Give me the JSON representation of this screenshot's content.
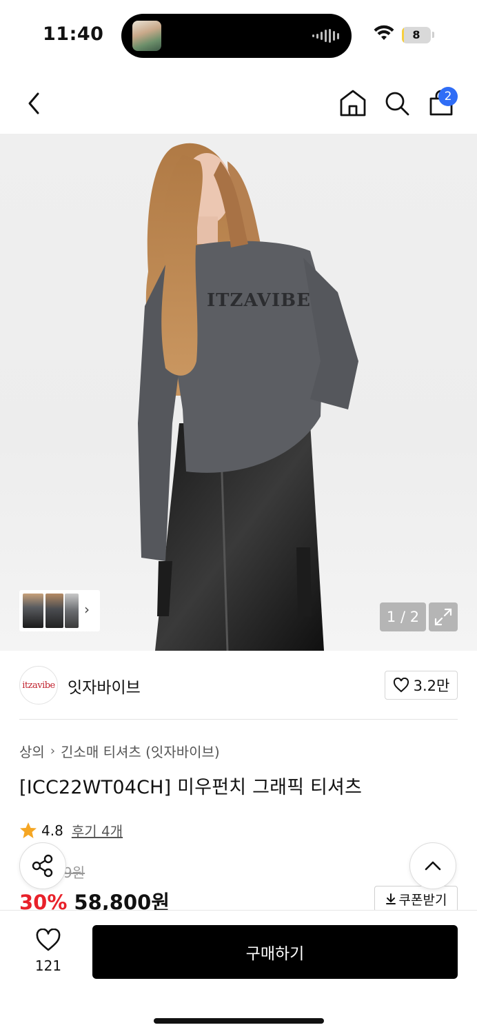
{
  "status_bar": {
    "time": "11:40",
    "battery_level": "8",
    "battery_fraction": 0.08
  },
  "nav": {
    "back_icon": "chevron-left-icon",
    "home_icon": "home-icon",
    "search_icon": "search-icon",
    "cart_icon": "shopping-bag-icon",
    "cart_count": "2",
    "badge_color": "#2f6df6"
  },
  "gallery": {
    "counter": "1 / 2",
    "expand_icon": "expand-icon",
    "thumb_arrow_icon": "chevron-right-icon"
  },
  "brand": {
    "logo_text": "itzavibe",
    "name": "잇자바이브",
    "like_count": "3.2만"
  },
  "product": {
    "breadcrumb": [
      "상의",
      "긴소매 티셔츠 (잇자바이브)"
    ],
    "title": "[ICC22WT04CH] 미우펀치 그래픽 티셔츠",
    "rating": "4.8",
    "review_link": "후기 4개",
    "original_price_partial": "9원",
    "discount": "30%",
    "price": "58,800원",
    "coupon_label": "쿠폰받기",
    "discount_color": "#e8212a"
  },
  "bottom_bar": {
    "wish_count": "121",
    "buy_label": "구매하기"
  }
}
